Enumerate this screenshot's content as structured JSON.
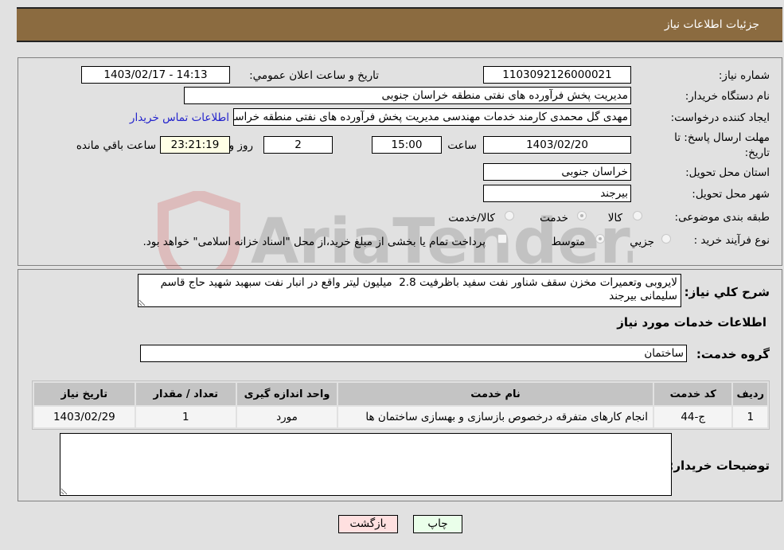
{
  "header": {
    "title": "جزئیات اطلاعات نیاز"
  },
  "form": {
    "need_number": {
      "label": "شماره نیاز:",
      "value": "1103092126000021"
    },
    "announce": {
      "label": "تاریخ و ساعت اعلان عمومي:",
      "value": "1403/02/17 - 14:13"
    },
    "buyer_org": {
      "label": "نام دستگاه خریدار:",
      "value": "مدیریت پخش فرآورده های نفتی منطقه خراسان جنوبی"
    },
    "requester": {
      "label": "ایجاد کننده درخواست:",
      "value": "مهدی گل محمدی کارمند خدمات مهندسی مدیریت پخش فرآورده های نفتی منطقه خراسان جنوبی"
    },
    "contact_link": "اطلاعات تماس خریدار",
    "deadline": {
      "label_line1": "مهلت ارسال پاسخ: تا",
      "label_line2": "تاریخ:",
      "date": "1403/02/20",
      "time_label": "ساعت",
      "time": "15:00",
      "days": "2",
      "days_label": "روز و",
      "remaining": "23:21:19",
      "remaining_label": "ساعت باقي مانده"
    },
    "province": {
      "label": "استان محل تحویل:",
      "value": "خراسان جنوبی"
    },
    "city": {
      "label": "شهر محل تحویل:",
      "value": "بیرجند"
    },
    "category": {
      "label": "طبقه بندی موضوعی:",
      "options": [
        {
          "label": "کالا",
          "checked": false
        },
        {
          "label": "خدمت",
          "checked": true
        },
        {
          "label": "کالا/خدمت",
          "checked": false
        }
      ]
    },
    "process": {
      "label": "نوع فرآیند خرید :",
      "options": [
        {
          "label": "جزيي",
          "checked": false
        },
        {
          "label": "متوسط",
          "checked": true
        }
      ],
      "treasury_note": "پرداخت تمام یا بخشی از مبلغ خرید،از محل \"اسناد خزانه اسلامی\" خواهد بود."
    }
  },
  "description": {
    "label": "شرح کلي نیاز:",
    "value": "لایروبی وتعمیرات مخزن سقف شناور نفت سفید باظرفیت 2.8  میلیون لیتر واقع در انبار نفت سبهبد شهید حاج قاسم سلیمانی بیرجند"
  },
  "services": {
    "section_title": "اطلاعات خدمات مورد نیاز",
    "group_label": "گروه خدمت:",
    "group_value": "ساختمان",
    "table": {
      "headers": [
        "ردیف",
        "کد خدمت",
        "نام خدمت",
        "واحد اندازه گیری",
        "تعداد / مقدار",
        "تاریخ نیاز"
      ],
      "rows": [
        [
          "1",
          "ج-44",
          "انجام کارهای متفرقه درخصوص بازسازی و بهسازی ساختمان ها",
          "مورد",
          "1",
          "1403/02/29"
        ]
      ]
    }
  },
  "buyer_notes": {
    "label": "توضیحات خریدار:",
    "value": ""
  },
  "buttons": {
    "print": "چاپ",
    "back": "بازگشت"
  },
  "watermark": {
    "text": "AriaTender.neT"
  },
  "colors": {
    "header_bg": "#8b6b40",
    "print_bg": "#eaffea",
    "back_bg": "#ffe0e0",
    "link": "#2222cc"
  }
}
